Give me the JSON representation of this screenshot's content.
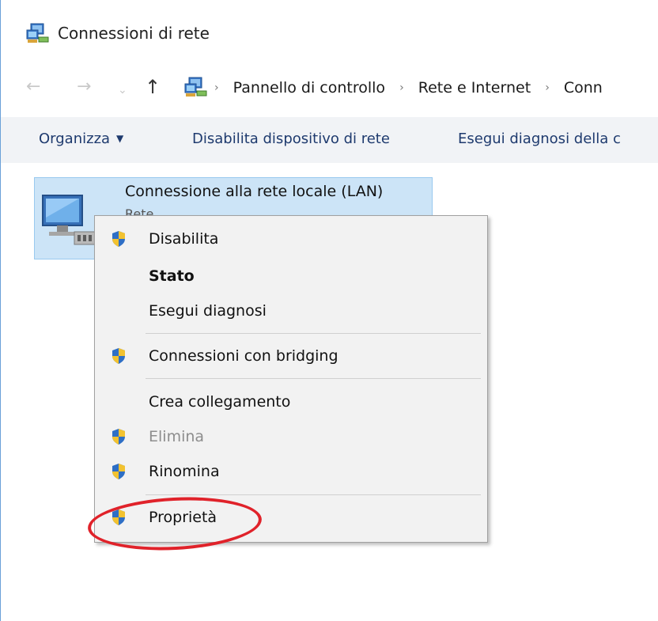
{
  "window": {
    "title": "Connessioni di rete"
  },
  "navigation": {
    "back_icon": "arrow-left-icon",
    "forward_icon": "arrow-right-icon",
    "recent_icon": "chevron-down-icon",
    "up_icon": "arrow-up-icon",
    "breadcrumb": [
      "Pannello di controllo",
      "Rete e Internet",
      "Conn"
    ]
  },
  "command_bar": {
    "organize_label": "Organizza",
    "disable_device_label": "Disabilita dispositivo di rete",
    "diagnose_label": "Esegui diagnosi della c"
  },
  "connection": {
    "name": "Connessione alla rete locale (LAN)",
    "subtitle": "Rete"
  },
  "context_menu": {
    "items": [
      {
        "label": "Disabilita",
        "shield": true,
        "bold": false,
        "disabled": false
      },
      {
        "label": "Stato",
        "shield": false,
        "bold": true,
        "disabled": false
      },
      {
        "label": "Esegui diagnosi",
        "shield": false,
        "bold": false,
        "disabled": false
      },
      {
        "label": "Connessioni con bridging",
        "shield": true,
        "bold": false,
        "disabled": false
      },
      {
        "label": "Crea collegamento",
        "shield": false,
        "bold": false,
        "disabled": false
      },
      {
        "label": "Elimina",
        "shield": true,
        "bold": false,
        "disabled": true
      },
      {
        "label": "Rinomina",
        "shield": true,
        "bold": false,
        "disabled": false
      },
      {
        "label": "Proprietà",
        "shield": true,
        "bold": false,
        "disabled": false
      }
    ]
  },
  "colors": {
    "selection_bg": "#cce4f7",
    "highlight_circle": "#e0222a",
    "menu_bg": "#f2f2f2"
  }
}
